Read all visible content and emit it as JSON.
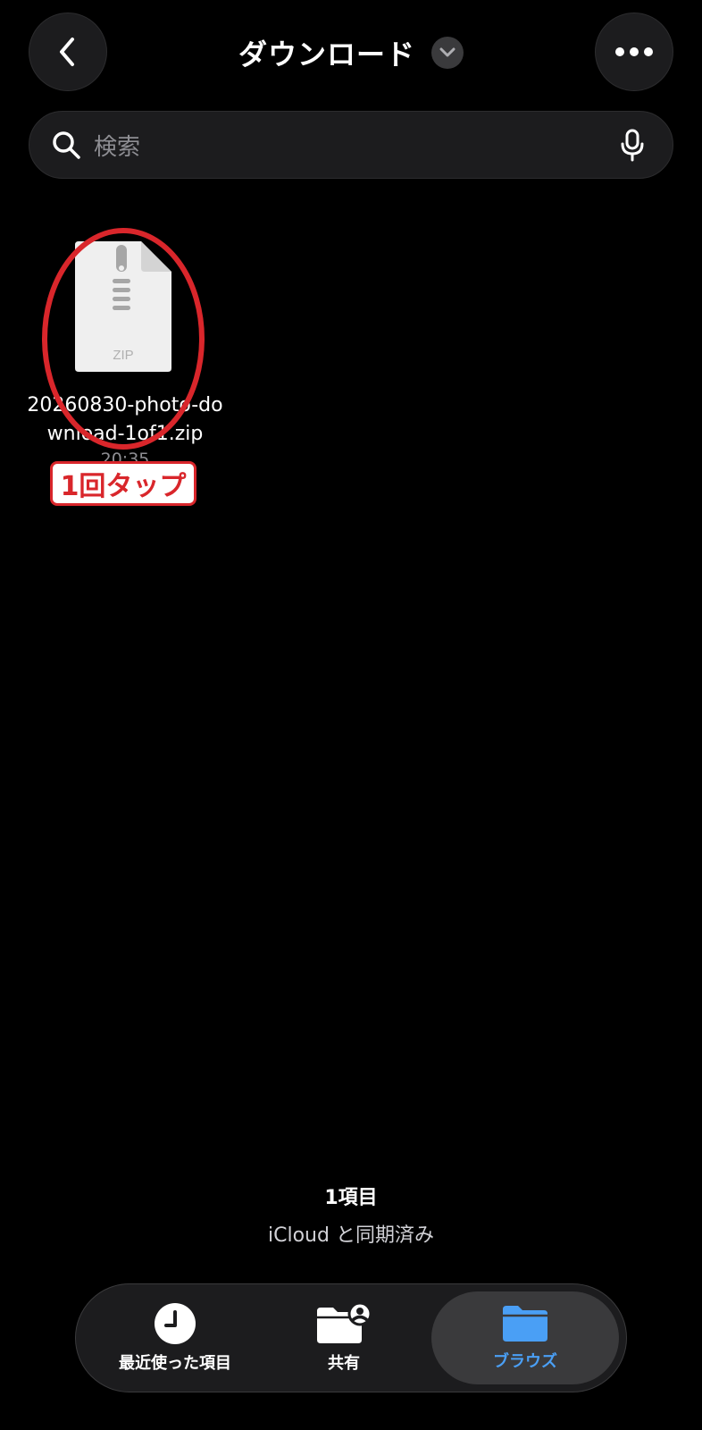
{
  "header": {
    "title": "ダウンロード",
    "back_icon": "chevron-left-icon",
    "dropdown_icon": "chevron-down-icon",
    "more_icon": "ellipsis-icon"
  },
  "search": {
    "placeholder": "検索",
    "search_icon": "magnifier-icon",
    "mic_icon": "microphone-icon"
  },
  "files": [
    {
      "name": "20260830-photo-download-1of1.zip",
      "time": "20:35",
      "icon": "zip-file-icon",
      "icon_label": "ZIP"
    }
  ],
  "annotation": {
    "label": "1回タップ",
    "color": "#d9262b"
  },
  "footer": {
    "item_count": "1項目",
    "sync_status": "iCloud と同期済み"
  },
  "tabs": [
    {
      "label": "最近使った項目",
      "icon": "clock-icon",
      "selected": false
    },
    {
      "label": "共有",
      "icon": "shared-folder-icon",
      "selected": false
    },
    {
      "label": "ブラウズ",
      "icon": "folder-icon",
      "selected": true
    }
  ],
  "colors": {
    "background": "#000000",
    "accent": "#4a9ff5",
    "annotation_red": "#d9262b"
  }
}
